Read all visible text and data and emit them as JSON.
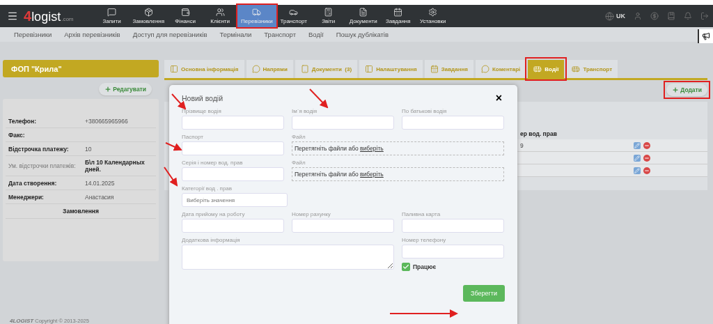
{
  "top_nav": {
    "logo": {
      "digit": "4",
      "word": "logist",
      "suffix": ".com"
    },
    "items": [
      {
        "label": "Запити",
        "selected": false
      },
      {
        "label": "Замовлення",
        "selected": false
      },
      {
        "label": "Фінанси",
        "selected": false
      },
      {
        "label": "Клієнти",
        "selected": false
      },
      {
        "label": "Перевізники",
        "selected": true
      },
      {
        "label": "Транспорт",
        "selected": false
      },
      {
        "label": "Звіти",
        "selected": false
      },
      {
        "label": "Документи",
        "selected": false
      },
      {
        "label": "Завдання",
        "selected": false
      },
      {
        "label": "Установки",
        "selected": false
      }
    ],
    "language": "UK"
  },
  "sub_nav": {
    "items": [
      "Перевізники",
      "Архів перевізників",
      "Доступ для перевізників",
      "Термінали",
      "Транспорт",
      "Водії",
      "Пошук дублікатів"
    ]
  },
  "carrier": {
    "name": "ФОП \"Крила\"",
    "edit_button": "Редагувати",
    "details": [
      {
        "label": "Телефон:",
        "value": "+380665965966",
        "kind": "bold_label"
      },
      {
        "label": "Факс:",
        "kind": "bold_label"
      },
      {
        "label": "Відстрочка платежу:",
        "value": "10",
        "kind": "bold_label"
      },
      {
        "label": "Ум. відстрочки платежів:",
        "value": "Б\\л 10 Календарных дней.",
        "kind": "bold_value"
      },
      {
        "label": "Дата створення:",
        "value": "14.01.2025",
        "kind": "bold_label"
      },
      {
        "label": "Менеджери:",
        "value": "Анастасия",
        "kind": "bold_label"
      }
    ],
    "orders_link": "Замовлення"
  },
  "tabs": [
    {
      "label": "Основна інформація",
      "selected": false
    },
    {
      "label": "Напрями",
      "selected": false
    },
    {
      "label": "Документи  (3)",
      "selected": false
    },
    {
      "label": "Налаштування",
      "selected": false
    },
    {
      "label": "Завдання",
      "selected": false
    },
    {
      "label": "Коментарі",
      "selected": false
    },
    {
      "label": "Водії",
      "selected": true
    },
    {
      "label": "Транспорт",
      "selected": false
    }
  ],
  "add_button": "Додати",
  "drivers_table": {
    "column_header": "ер вод. прав",
    "rows": [
      {
        "licence": "9"
      },
      {},
      {}
    ]
  },
  "footer": {
    "brand": "4LOGIST",
    "copyright": "Copyright © 2013-2025"
  },
  "modal": {
    "title": "Новий водій",
    "close": "×",
    "rows": [
      [
        {
          "kind": "input",
          "label": "Прізвище водія"
        },
        {
          "kind": "input",
          "label": "Ім`я водія"
        },
        {
          "kind": "input",
          "label": "По батькові водія"
        }
      ],
      [
        {
          "kind": "input",
          "label": "Паспорт"
        },
        {
          "kind": "file",
          "label": "Файл",
          "colspan": 2,
          "drop_text": "Перетягніть файли або ",
          "link": "виберіть"
        }
      ],
      [
        {
          "kind": "input",
          "label": "Серія і номер вод. прав"
        },
        {
          "kind": "file",
          "label": "Файл",
          "colspan": 2,
          "drop_text": "Перетягніть файли або ",
          "link": "виберіть"
        }
      ],
      [
        {
          "kind": "select",
          "label": "Категорії вод . прав",
          "placeholder": "Виберіть значення"
        }
      ],
      [
        {
          "kind": "input",
          "label": "Дата прийому на роботу"
        },
        {
          "kind": "input",
          "label": "Номер рахунку"
        },
        {
          "kind": "input",
          "label": "Паливна карта"
        }
      ],
      [
        {
          "kind": "textarea",
          "label": "Додаткова інформація",
          "colspan": 2
        },
        {
          "kind": "input",
          "label": "Номер телефону",
          "checkbox": {
            "label": "Працює",
            "checked": true
          }
        }
      ]
    ],
    "save_button": "Зберегти"
  }
}
